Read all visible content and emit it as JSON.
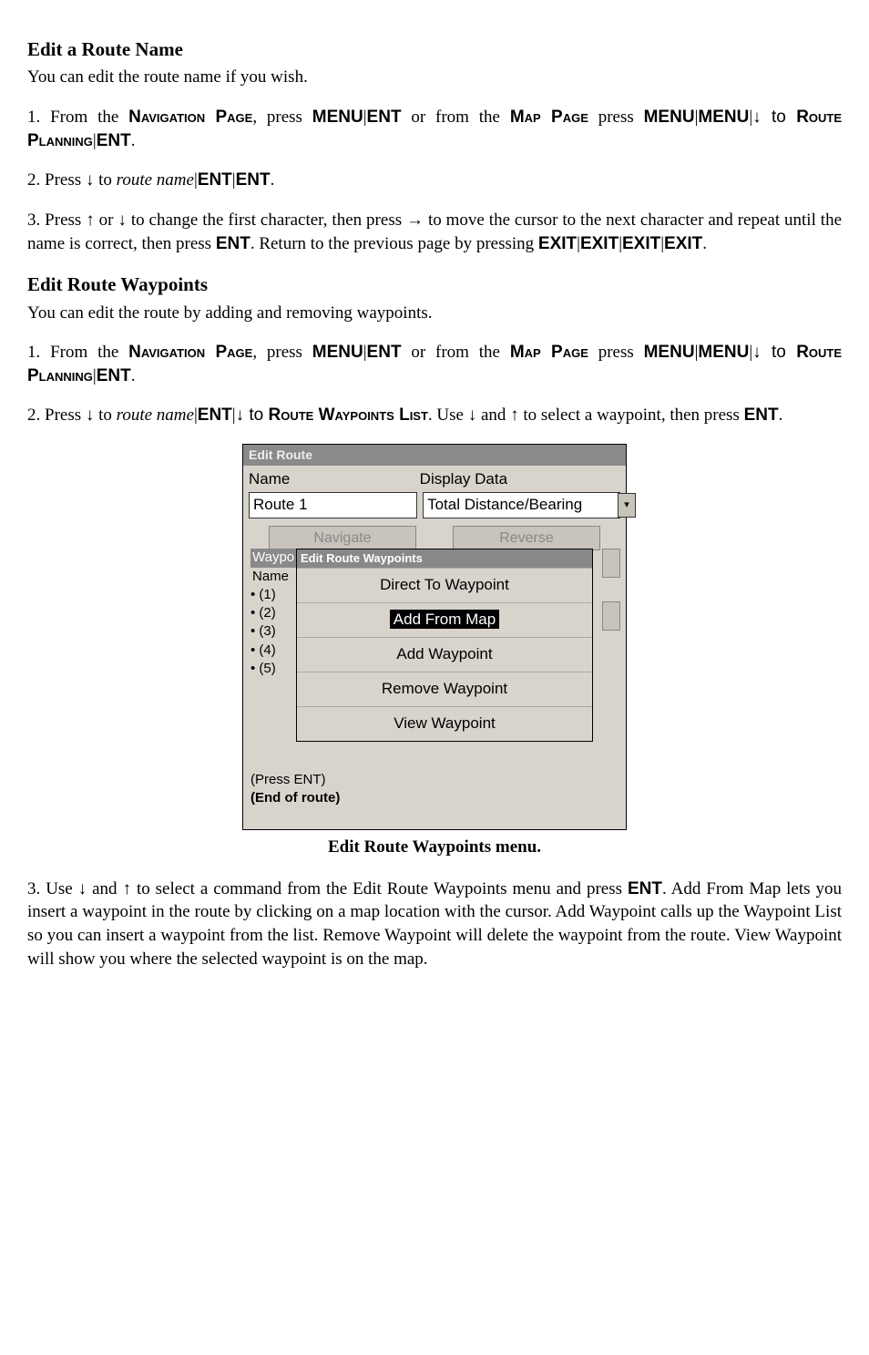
{
  "headings": {
    "edit_route_name": "Edit a Route Name",
    "edit_route_wp": "Edit Route Waypoints"
  },
  "paras": {
    "ern_intro": "You can edit the route name if you wish.",
    "ern_s1_a": "1. From the ",
    "nav_page": "Navigation Page",
    "ern_s1_b": ", press ",
    "menu": "MENU",
    "ent": "ENT",
    "map_page": "Map Page",
    "ern_s1_c": " or from the ",
    "ern_s1_d": " press ",
    "route_planning": "Route Planning",
    "down_to": "↓ to ",
    "ern_s2_a": "2. Press ↓ to ",
    "route_name_i": "route name",
    "ern_s3": "3. Press ↑ or ↓ to change the first character, then press → to move the cursor to the next character and repeat until the name is correct, then press ",
    "ern_s3_b": ". Return to the previous page by pressing ",
    "exit": "EXIT",
    "erw_intro": "You can edit the route by adding and removing waypoints.",
    "erw_s2_a": "2. Press ↓ to ",
    "erw_s2_b": "↓ to ",
    "route_wp_list": "Route Waypoints List",
    "erw_s2_c": ". Use ↓ and ↑ to select a waypoint, then press ",
    "erw_s3": "3. Use ↓  and ↑ to select a command from the Edit Route Waypoints menu and press ",
    "erw_s3_b": ". Add From Map lets you insert a waypoint in the route by clicking on a map location with the cursor. Add Waypoint calls up the Waypoint List so you can insert a waypoint from the list. Remove Waypoint will delete the waypoint from the route. View Waypoint will show you where the selected waypoint is on the map."
  },
  "dialog": {
    "title": "Edit Route",
    "name_label": "Name",
    "display_data_label": "Display Data",
    "name_value": "Route 1",
    "display_value": "Total Distance/Bearing",
    "btn_left_partial": "Navigate",
    "btn_right_partial": "Reverse",
    "submenu_title": "Edit Route Waypoints",
    "submenu_items": [
      "Direct To Waypoint",
      "Add From Map",
      "Add Waypoint",
      "Remove Waypoint",
      "View Waypoint"
    ],
    "side_waypo": "Waypo",
    "side_name": "Name",
    "wp_list": [
      "(1)",
      "(2)",
      "(3)",
      "(4)",
      "(5)"
    ],
    "press_ent": "(Press ENT)",
    "end_route": "(End of route)"
  },
  "caption": "Edit Route Waypoints menu."
}
